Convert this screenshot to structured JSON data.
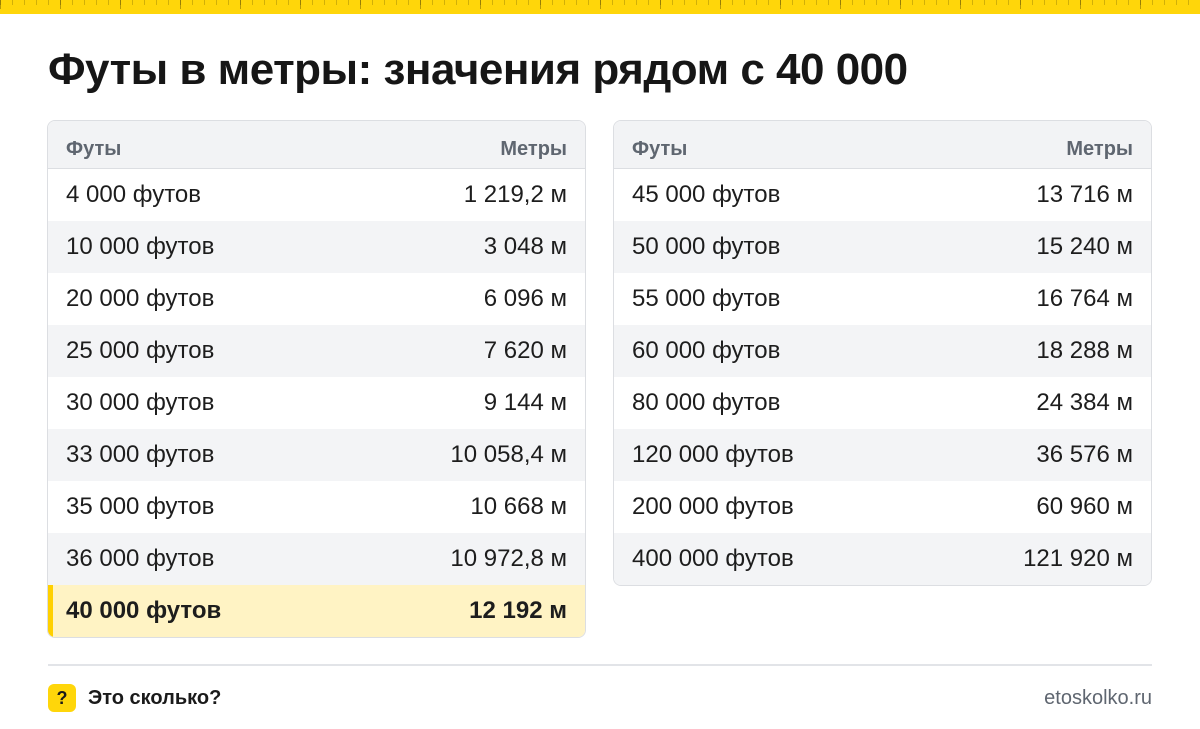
{
  "title": "Футы в метры: значения рядом с 40 000",
  "columns": {
    "feet": "Футы",
    "meters": "Метры"
  },
  "left_table": [
    {
      "feet": "4 000 футов",
      "meters": "1 219,2 м"
    },
    {
      "feet": "10 000 футов",
      "meters": "3 048 м"
    },
    {
      "feet": "20 000 футов",
      "meters": "6 096 м"
    },
    {
      "feet": "25 000 футов",
      "meters": "7 620 м"
    },
    {
      "feet": "30 000 футов",
      "meters": "9 144 м"
    },
    {
      "feet": "33 000 футов",
      "meters": "10 058,4 м"
    },
    {
      "feet": "35 000 футов",
      "meters": "10 668 м"
    },
    {
      "feet": "36 000 футов",
      "meters": "10 972,8 м"
    },
    {
      "feet": "40 000 футов",
      "meters": "12 192 м"
    }
  ],
  "right_table": [
    {
      "feet": "45 000 футов",
      "meters": "13 716 м"
    },
    {
      "feet": "50 000 футов",
      "meters": "15 240 м"
    },
    {
      "feet": "55 000 футов",
      "meters": "16 764 м"
    },
    {
      "feet": "60 000 футов",
      "meters": "18 288 м"
    },
    {
      "feet": "80 000 футов",
      "meters": "24 384 м"
    },
    {
      "feet": "120 000 футов",
      "meters": "36 576 м"
    },
    {
      "feet": "200 000 футов",
      "meters": "60 960 м"
    },
    {
      "feet": "400 000 футов",
      "meters": "121 920 м"
    }
  ],
  "footer": {
    "badge": "?",
    "brand": "Это сколько?",
    "site": "etoskolko.ru"
  },
  "colors": {
    "accent": "#ffd60a",
    "highlight_row": "#fff3c4",
    "header_bg": "#f2f3f5",
    "border": "#dcdee2"
  }
}
